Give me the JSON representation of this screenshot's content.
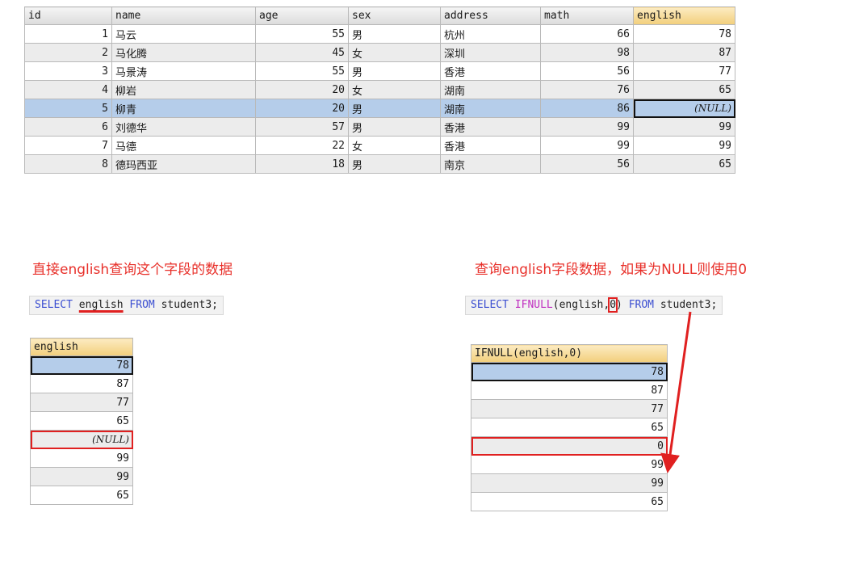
{
  "main_table": {
    "columns": [
      "id",
      "name",
      "age",
      "sex",
      "address",
      "math",
      "english"
    ],
    "rows": [
      {
        "id": "1",
        "name": "马云",
        "age": "55",
        "sex": "男",
        "address": "杭州",
        "math": "66",
        "english": "78"
      },
      {
        "id": "2",
        "name": "马化腾",
        "age": "45",
        "sex": "女",
        "address": "深圳",
        "math": "98",
        "english": "87"
      },
      {
        "id": "3",
        "name": "马景涛",
        "age": "55",
        "sex": "男",
        "address": "香港",
        "math": "56",
        "english": "77"
      },
      {
        "id": "4",
        "name": "柳岩",
        "age": "20",
        "sex": "女",
        "address": "湖南",
        "math": "76",
        "english": "65"
      },
      {
        "id": "5",
        "name": "柳青",
        "age": "20",
        "sex": "男",
        "address": "湖南",
        "math": "86",
        "english": "(NULL)"
      },
      {
        "id": "6",
        "name": "刘德华",
        "age": "57",
        "sex": "男",
        "address": "香港",
        "math": "99",
        "english": "99"
      },
      {
        "id": "7",
        "name": "马德",
        "age": "22",
        "sex": "女",
        "address": "香港",
        "math": "99",
        "english": "99"
      },
      {
        "id": "8",
        "name": "德玛西亚",
        "age": "18",
        "sex": "男",
        "address": "南京",
        "math": "56",
        "english": "65"
      }
    ]
  },
  "left": {
    "caption": "直接english查询这个字段的数据",
    "sql": {
      "select": "SELECT",
      "column": "english",
      "from": "FROM",
      "table": "student3;"
    },
    "result_header": "english",
    "values": [
      "78",
      "87",
      "77",
      "65",
      "(NULL)",
      "99",
      "99",
      "65"
    ]
  },
  "right": {
    "caption": "查询english字段数据，如果为NULL则使用0",
    "sql": {
      "select": "SELECT",
      "fn": "IFNULL",
      "open": "(english,",
      "arg": "0",
      "close": ")",
      "from": "FROM",
      "table": "student3;"
    },
    "result_header": "IFNULL(english,0)",
    "values": [
      "78",
      "87",
      "77",
      "65",
      "0",
      "99",
      "99",
      "65"
    ]
  },
  "colors": {
    "highlight_red": "#e02020",
    "selected_row": "#b5cdea",
    "keyword_blue": "#3c4fd1",
    "function_purple": "#c030c0"
  }
}
